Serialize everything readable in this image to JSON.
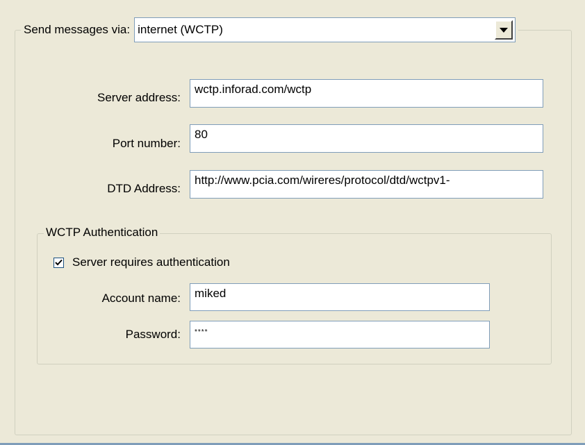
{
  "send_via": {
    "label": "Send messages via:",
    "selected": "internet (WCTP)"
  },
  "server_address": {
    "label": "Server address:",
    "value": "wctp.inforad.com/wctp"
  },
  "port_number": {
    "label": "Port number:",
    "value": "80"
  },
  "dtd_address": {
    "label": "DTD Address:",
    "value": "http://www.pcia.com/wireres/protocol/dtd/wctpv1-"
  },
  "authentication": {
    "group_title": "WCTP Authentication",
    "requires_auth_label": "Server requires authentication",
    "requires_auth_checked": true,
    "account_name_label": "Account name:",
    "account_name_value": "miked",
    "password_label": "Password:",
    "password_value": "****"
  },
  "icons": {
    "dropdown": "chevron-down-icon",
    "checkbox": "checkmark-icon"
  }
}
